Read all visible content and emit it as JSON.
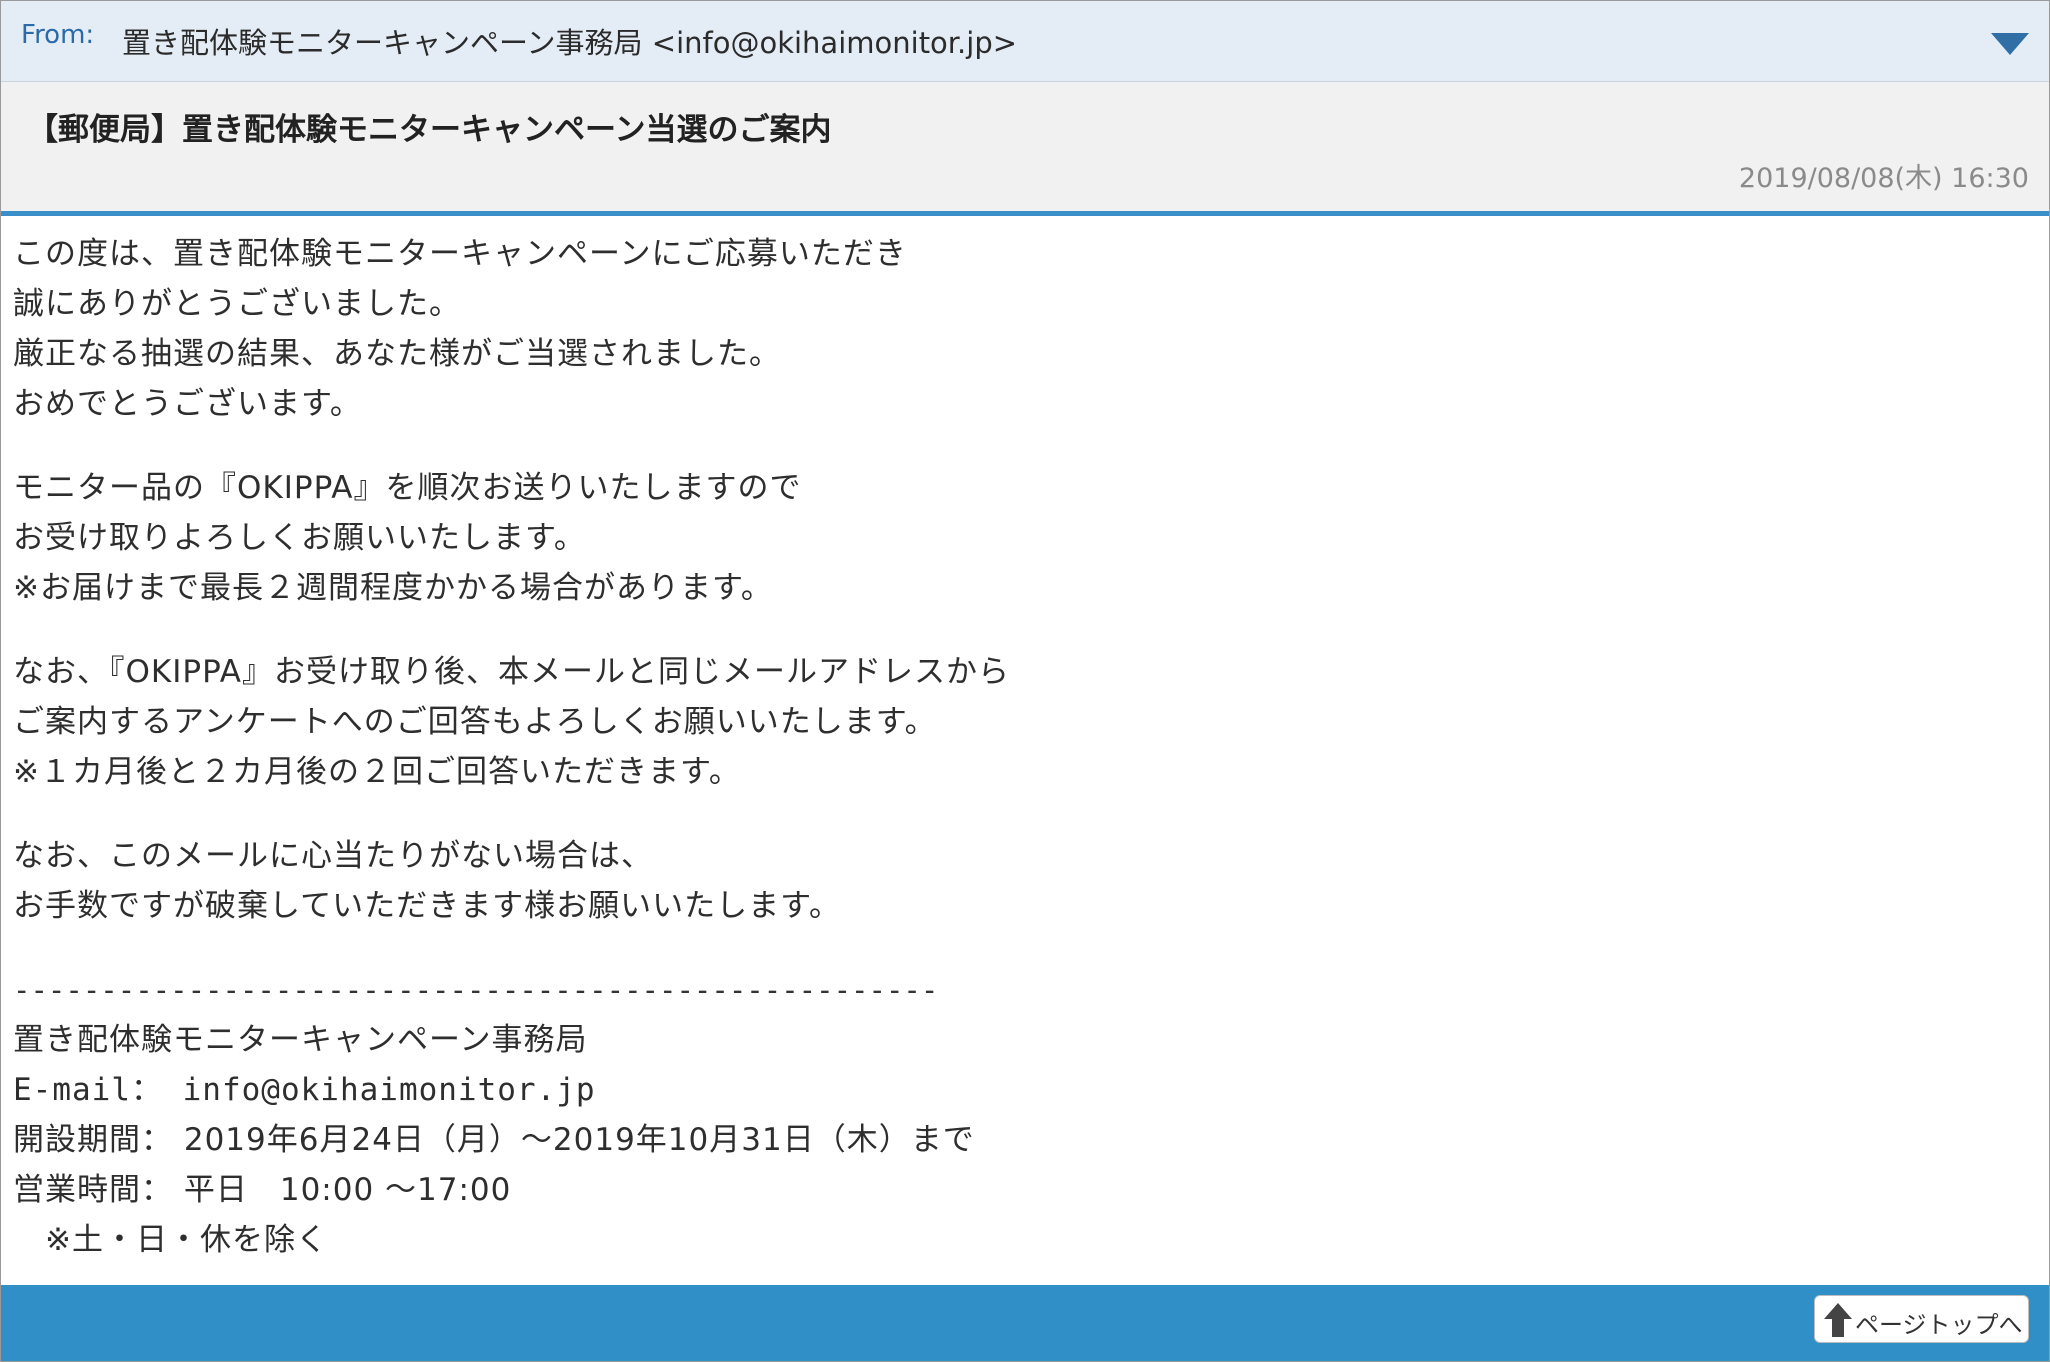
{
  "header": {
    "from_label": "From:",
    "from_value": "置き配体験モニターキャンペーン事務局 <info@okihaimonitor.jp>",
    "expand_icon": "triangle-down-icon"
  },
  "message": {
    "subject": "【郵便局】置き配体験モニターキャンペーン当選のご案内",
    "date": "2019/08/08(木) 16:30",
    "paragraphs": [
      {
        "lines": [
          "この度は、置き配体験モニターキャンペーンにご応募いただき",
          "誠にありがとうございました。",
          "厳正なる抽選の結果、あなた様がご当選されました。",
          "おめでとうございます。"
        ]
      },
      {
        "lines": [
          "モニター品の『OKIPPA』を順次お送りいたしますので",
          "お受け取りよろしくお願いいたします。",
          "※お届けまで最長２週間程度かかる場合があります。"
        ]
      },
      {
        "lines": [
          "なお、『OKIPPA』お受け取り後、本メールと同じメールアドレスから",
          "ご案内するアンケートへのご回答もよろしくお願いいたします。",
          "※１カ月後と２カ月後の２回ご回答いただきます。"
        ]
      },
      {
        "lines": [
          "なお、このメールに心当たりがない場合は、",
          "お手数ですが破棄していただきます様お願いいたします。"
        ]
      }
    ],
    "signature": {
      "divider": "-----------------------------------------------------",
      "org": "置き配体験モニターキャンペーン事務局",
      "email": "E-mail： info@okihaimonitor.jp",
      "period": "開設期間： 2019年6月24日（月）〜2019年10月31日（木）まで",
      "hours": "営業時間： 平日　10:00 〜17:00",
      "note": "　※土・日・休を除く"
    }
  },
  "footer": {
    "page_top_label": "ページトップへ",
    "page_top_icon": "arrow-up-icon"
  },
  "colors": {
    "from_bar": "#e4edf5",
    "accent": "#3a8fc8",
    "footer": "#2f8fc6"
  }
}
